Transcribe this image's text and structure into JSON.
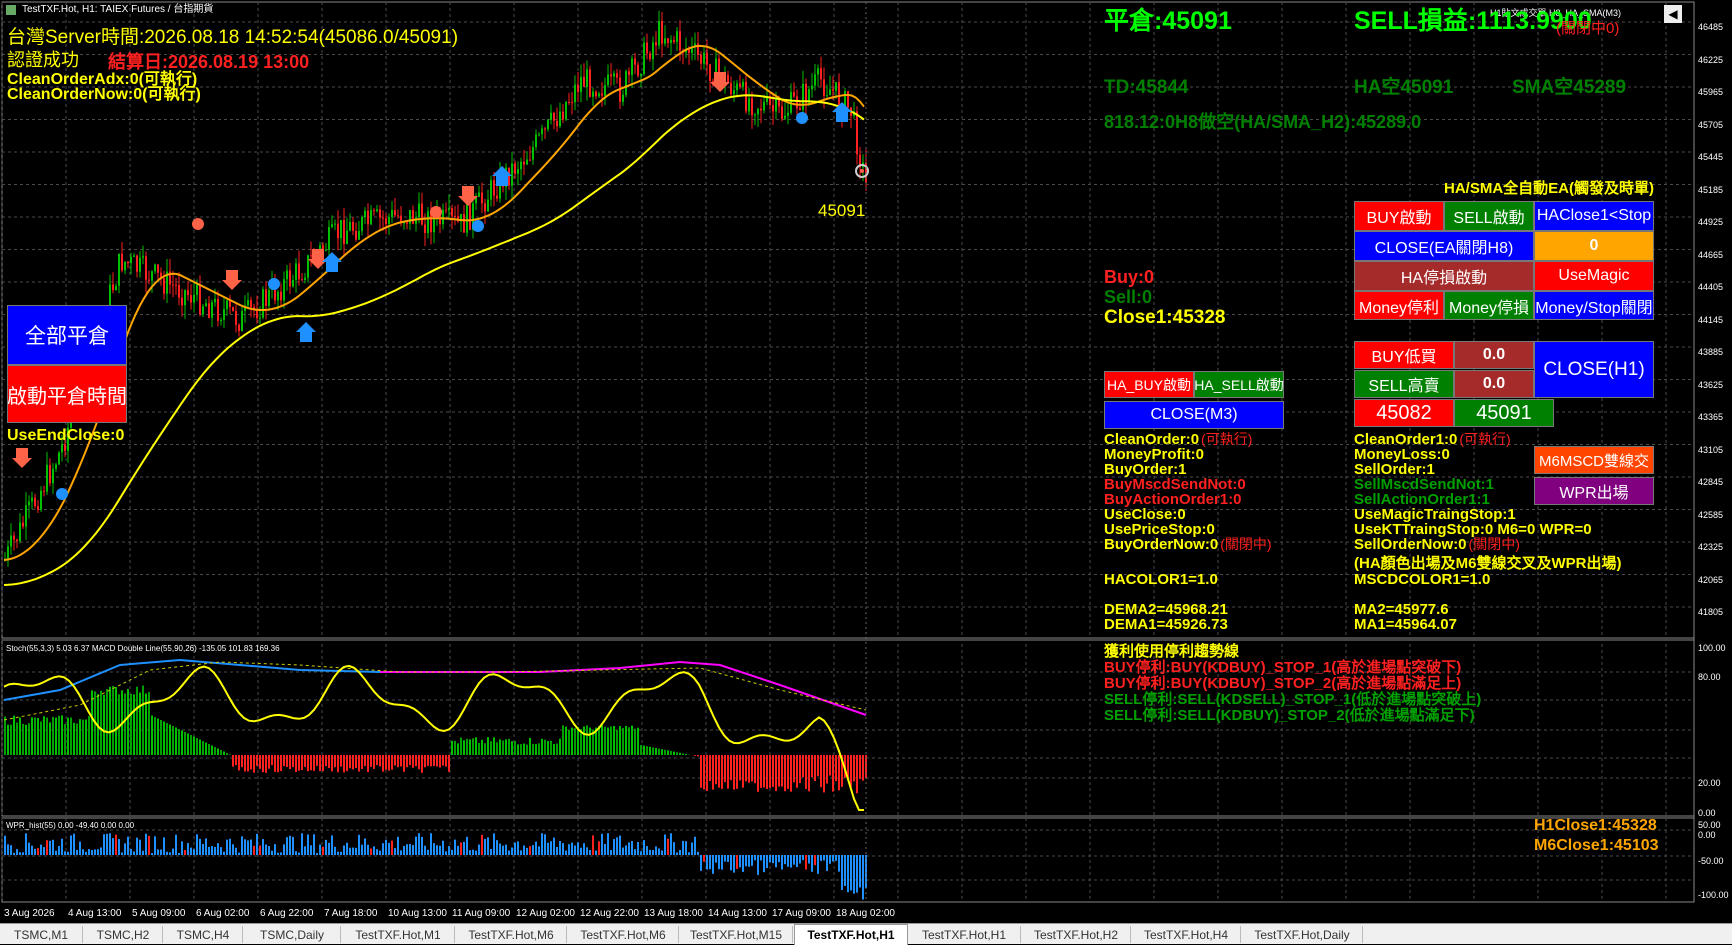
{
  "window": {
    "title": "TestTXF.Hot, H1:  TAIEX Futures / 台指期貨",
    "right_title": "H1貼文成交單 H8_HA_SMA(M3)"
  },
  "colors": {
    "bg": "#000000",
    "grid": "#4a4a4a",
    "bull": "#00c000",
    "bear": "#ff2020",
    "sma_fast": "#ffa500",
    "sma_slow": "#ffff00",
    "macd_line": "#1e90ff",
    "signal_line": "#ff00ff",
    "stoch_line": "#ffff00",
    "wpr_bar": "#1e90ff"
  },
  "top_left": {
    "server_time": "台灣Server時間:2026.08.18 14:52:54(45086.0/45091)",
    "auth": "認證成功",
    "expire": "結算日:2026.08.19 13:00",
    "clean_adx": "CleanOrderAdx:0(可執行)",
    "clean_now": "CleanOrderNow:0(可執行)"
  },
  "left_buttons": {
    "close_all": "全部平倉",
    "start_close_time": "啟動平倉時間",
    "use_end_close": "UseEndClose:0"
  },
  "price_tag": "45091",
  "top_right": {
    "close_price": "平倉:45091",
    "sell_pl": "SELL損益:1113.9900",
    "closed_note": "(關閉中0)",
    "td": "TD:45844",
    "ha": "HA空45091",
    "sma": "SMA空45289",
    "h8": "818.12:0H8做空(HA/SMA_H2):45289.0",
    "ea_title": "HA/SMA全自動EA(觸發及時單)"
  },
  "mid_status": {
    "buy": "Buy:0",
    "sell": "Sell:0",
    "close1": "Close1:45328"
  },
  "ea_buttons": {
    "buy_start": "BUY啟動",
    "sell_start": "SELL啟動",
    "haclose": "HAClose1<Stop",
    "close_ea": "CLOSE(EA關閉H8)",
    "zero": "0",
    "ha_stop": "HA停損啟動",
    "use_magic": "UseMagic",
    "money_tp": "Money停利",
    "money_sl": "Money停損",
    "money_stop_close": "Money/Stop關閉",
    "buy_low": "BUY低買",
    "buy_low_val": "0.0",
    "sell_high": "SELL高賣",
    "sell_high_val": "0.0",
    "close_h1": "CLOSE(H1)",
    "price1": "45082",
    "price2": "45091",
    "ha_buy": "HA_BUY啟動",
    "ha_sell": "HA_SELL啟動",
    "close_m3": "CLOSE(M3)",
    "m6mscd": "M6MSCD雙線交",
    "wpr_exit": "WPR出場"
  },
  "info_left": [
    {
      "text": "CleanOrder:0",
      "note": "(可執行)",
      "color": "#ffff00"
    },
    {
      "text": "MoneyProfit:0",
      "note": "",
      "color": "#ffff00"
    },
    {
      "text": "BuyOrder:1",
      "note": "",
      "color": "#ffff00"
    },
    {
      "text": "BuyMscdSendNot:0",
      "note": "",
      "color": "#ff2020"
    },
    {
      "text": "BuyActionOrder1:0",
      "note": "",
      "color": "#ff2020"
    },
    {
      "text": "UseClose:0",
      "note": "",
      "color": "#ffff00"
    },
    {
      "text": "UsePriceStop:0",
      "note": "",
      "color": "#ffff00"
    },
    {
      "text": "BuyOrderNow:0",
      "note": "(關閉中)",
      "color": "#ffff00"
    }
  ],
  "info_right": [
    {
      "text": "CleanOrder1:0",
      "note": "(可執行)",
      "color": "#ffff00"
    },
    {
      "text": "MoneyLoss:0",
      "note": "",
      "color": "#ffff00"
    },
    {
      "text": "SellOrder:1",
      "note": "",
      "color": "#ffff00"
    },
    {
      "text": "SellMscdSendNot:1",
      "note": "",
      "color": "#00a000"
    },
    {
      "text": "SellActionOrder1:1",
      "note": "",
      "color": "#00a000"
    },
    {
      "text": "UseMagicTraingStop:1",
      "note": "",
      "color": "#ffff00"
    },
    {
      "text": "UseKTTraingStop:0  M6=0  WPR=0",
      "note": "",
      "color": "#ffff00"
    },
    {
      "text": "SellOrderNow:0",
      "note": "(關閉中)",
      "color": "#ffff00"
    }
  ],
  "ha_note": "(HA顏色出場及M6雙線交叉及WPR出場)",
  "colors_info": {
    "hacolor": "HACOLOR1=1.0",
    "mscdcolor": "MSCDCOLOR1=1.0"
  },
  "ma_info": {
    "dema2": "DEMA2=45968.21",
    "dema1": "DEMA1=45926.73",
    "ma2": "MA2=45977.6",
    "ma1": "MA1=45964.07"
  },
  "trend_info": [
    {
      "text": "獲利使用停利趨勢線",
      "color": "#ffff00"
    },
    {
      "text": "BUY停利:BUY(KDBUY)_STOP_1(高於進場點突破下)",
      "color": "#ff2020"
    },
    {
      "text": "BUY停利:BUY(KDBUY)_STOP_2(高於進場點滿足上)",
      "color": "#ff2020"
    },
    {
      "text": "SELL停利:SELL(KDSELL)_STOP_1(低於進場點突破上)",
      "color": "#00a000"
    },
    {
      "text": "SELL停利:SELL(KDBUY)_STOP_2(低於進場點滿足下)",
      "color": "#00a000"
    }
  ],
  "sub1_title": "Stoch(55,3,3) 5.03 6.37 MACD Double Line(55,90,26) -135.05 101.83 169.36",
  "sub2_title": "WPR_hist(55) 0.00 -49.40 0.00 0.00",
  "wpr_info": {
    "h1close": "H1Close1:45328",
    "m6close": "M6Close1:45103"
  },
  "price_axis": [
    "46485",
    "46225",
    "45965",
    "45705",
    "45445",
    "45185",
    "44925",
    "44665",
    "44405",
    "44145",
    "43885",
    "43625",
    "43365",
    "43105",
    "42845",
    "42585",
    "42325",
    "42065",
    "41805"
  ],
  "sub1_axis": [
    "100.00",
    "80.00",
    "20.00",
    "0.00"
  ],
  "sub2_axis": [
    "50.00",
    "0.00",
    "-50.00",
    "-100.00"
  ],
  "time_axis": [
    "3 Aug 2026",
    "4 Aug 13:00",
    "5 Aug 09:00",
    "6 Aug 02:00",
    "6 Aug 22:00",
    "7 Aug 18:00",
    "10 Aug 13:00",
    "11 Aug 09:00",
    "12 Aug 02:00",
    "12 Aug 22:00",
    "13 Aug 18:00",
    "14 Aug 13:00",
    "17 Aug 09:00",
    "18 Aug 02:00"
  ],
  "tabs": [
    "TSMC,M1",
    "TSMC,H2",
    "TSMC,H4",
    "TSMC,Daily",
    "TestTXF.Hot,M1",
    "TestTXF.Hot,M6",
    "TestTXF.Hot,M6",
    "TestTXF.Hot,M15",
    "TestTXF.Hot,H1",
    "TestTXF.Hot,H1",
    "TestTXF.Hot,H2",
    "TestTXF.Hot,H4",
    "TestTXF.Hot,Daily"
  ],
  "active_tab": 8
}
